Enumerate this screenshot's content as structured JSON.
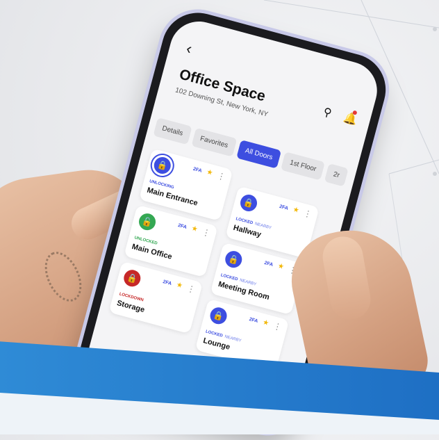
{
  "app": {
    "back_icon": "chevron-left-icon",
    "title": "Office Space",
    "address": "102 Downing St, New York, NY",
    "search_icon": "search-icon",
    "bell_icon": "bell-icon"
  },
  "tabs": [
    {
      "label": "Details",
      "active": false
    },
    {
      "label": "Favorites",
      "active": false
    },
    {
      "label": "All Doors",
      "active": true
    },
    {
      "label": "1st Floor",
      "active": false
    },
    {
      "label": "2r",
      "active": false
    }
  ],
  "doors": [
    {
      "name": "Main Entrance",
      "status": "UNLOCKING",
      "nearby": "",
      "badge": "2FA",
      "color": "#3d4ee0",
      "favorite": true
    },
    {
      "name": "Hallway",
      "status": "LOCKED",
      "nearby": "NEARBY",
      "badge": "2FA",
      "color": "#3d4ee0",
      "favorite": true
    },
    {
      "name": "Main Office",
      "status": "UNLOCKED",
      "nearby": "",
      "badge": "2FA",
      "color": "#34a853",
      "favorite": true
    },
    {
      "name": "Meeting Room",
      "status": "LOCKED",
      "nearby": "NEARBY",
      "badge": "2FA",
      "color": "#3d4ee0",
      "favorite": true
    },
    {
      "name": "Storage",
      "status": "LOCKDOWN",
      "nearby": "",
      "badge": "2FA",
      "color": "#c62828",
      "favorite": true
    },
    {
      "name": "Lounge",
      "status": "LOCKED",
      "nearby": "NEARBY",
      "badge": "2FA",
      "color": "#3d4ee0",
      "favorite": true
    }
  ],
  "colors": {
    "accent": "#3d4ee0",
    "unlocked": "#34a853",
    "lockdown": "#c62828",
    "favorite_star": "#f2b705",
    "band": "#1e6fc4"
  }
}
